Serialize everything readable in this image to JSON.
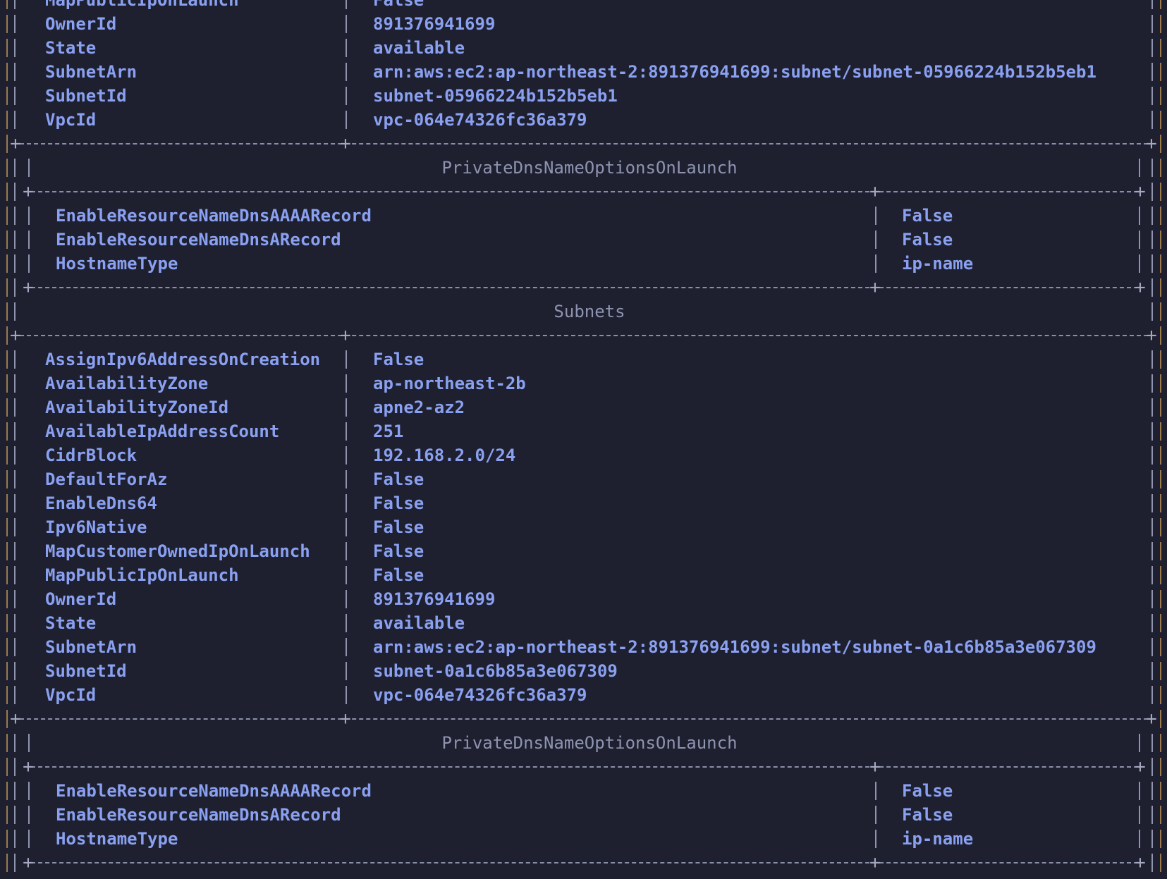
{
  "terminal": {
    "colors": {
      "background": "#1e2030",
      "text": "#8aa0f0",
      "title": "#8e93b0",
      "border_outer": "#9c7a4c",
      "border_inner": "#8f93ac"
    },
    "block1": {
      "rows": [
        {
          "key": "MapPublicIpOnLaunch",
          "value": "False"
        },
        {
          "key": "OwnerId",
          "value": "891376941699"
        },
        {
          "key": "State",
          "value": "available"
        },
        {
          "key": "SubnetArn",
          "value": "arn:aws:ec2:ap-northeast-2:891376941699:subnet/subnet-05966224b152b5eb1"
        },
        {
          "key": "SubnetId",
          "value": "subnet-05966224b152b5eb1"
        },
        {
          "key": "VpcId",
          "value": "vpc-064e74326fc36a379"
        }
      ],
      "dns_title": "PrivateDnsNameOptionsOnLaunch",
      "dns_rows": [
        {
          "key": "EnableResourceNameDnsAAAARecord",
          "value": "False"
        },
        {
          "key": "EnableResourceNameDnsARecord",
          "value": "False"
        },
        {
          "key": "HostnameType",
          "value": "ip-name"
        }
      ]
    },
    "subnets_title": "Subnets",
    "block2": {
      "rows": [
        {
          "key": "AssignIpv6AddressOnCreation",
          "value": "False"
        },
        {
          "key": "AvailabilityZone",
          "value": "ap-northeast-2b"
        },
        {
          "key": "AvailabilityZoneId",
          "value": "apne2-az2"
        },
        {
          "key": "AvailableIpAddressCount",
          "value": "251"
        },
        {
          "key": "CidrBlock",
          "value": "192.168.2.0/24"
        },
        {
          "key": "DefaultForAz",
          "value": "False"
        },
        {
          "key": "EnableDns64",
          "value": "False"
        },
        {
          "key": "Ipv6Native",
          "value": "False"
        },
        {
          "key": "MapCustomerOwnedIpOnLaunch",
          "value": "False"
        },
        {
          "key": "MapPublicIpOnLaunch",
          "value": "False"
        },
        {
          "key": "OwnerId",
          "value": "891376941699"
        },
        {
          "key": "State",
          "value": "available"
        },
        {
          "key": "SubnetArn",
          "value": "arn:aws:ec2:ap-northeast-2:891376941699:subnet/subnet-0a1c6b85a3e067309"
        },
        {
          "key": "SubnetId",
          "value": "subnet-0a1c6b85a3e067309"
        },
        {
          "key": "VpcId",
          "value": "vpc-064e74326fc36a379"
        }
      ],
      "dns_title": "PrivateDnsNameOptionsOnLaunch",
      "dns_rows": [
        {
          "key": "EnableResourceNameDnsAAAARecord",
          "value": "False"
        },
        {
          "key": "EnableResourceNameDnsARecord",
          "value": "False"
        },
        {
          "key": "HostnameType",
          "value": "ip-name"
        }
      ]
    }
  }
}
